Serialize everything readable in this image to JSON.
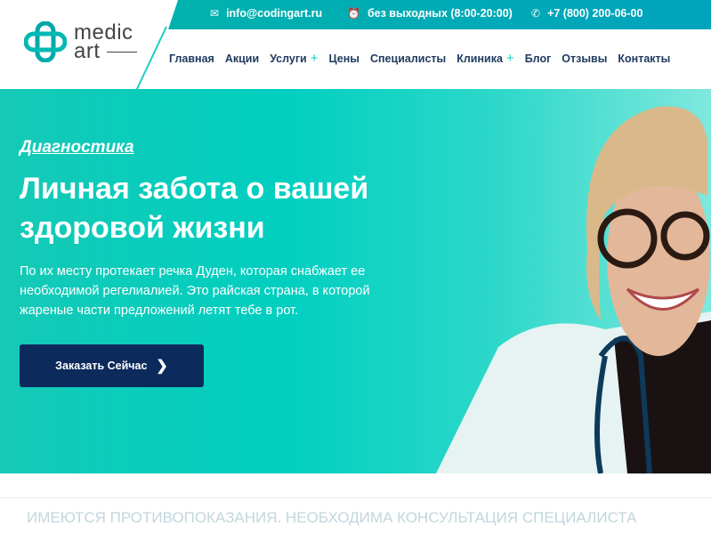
{
  "logo": {
    "line1": "medic",
    "line2": "art"
  },
  "topbar": {
    "email": "info@codingart.ru",
    "hours": "без выходных (8:00-20:00)",
    "phone": "+7 (800) 200-06-00",
    "email_icon": "envelope-icon",
    "hours_icon": "alarm-clock-icon",
    "phone_icon": "phone-icon"
  },
  "nav": {
    "items": [
      {
        "label": "Главная"
      },
      {
        "label": "Акции"
      },
      {
        "label": "Услуги",
        "plus": "+"
      },
      {
        "label": "Цены"
      },
      {
        "label": "Специалисты"
      },
      {
        "label": "Клиника",
        "plus": "+"
      },
      {
        "label": "Блог"
      },
      {
        "label": "Отзывы"
      },
      {
        "label": "Контакты"
      }
    ]
  },
  "hero": {
    "kicker": "Диагностика",
    "title": "Личная забота о вашей здоровой жизни",
    "description": "По их месту протекает речка Дуден, которая снабжает ее необходимой регелиалией. Это райская страна, в которой жареные части предложений летят тебе в рот.",
    "cta": "Заказать Сейчас",
    "cta_icon": "chevron-right-icon"
  },
  "notice": "ИМЕЮТСЯ ПРОТИВОПОКАЗАНИЯ. НЕОБХОДИМА КОНСУЛЬТАЦИЯ СПЕЦИАЛИСТА",
  "colors": {
    "accent": "#00b3ad",
    "navy": "#0d2a5c",
    "nav_text": "#1e3a5f"
  }
}
